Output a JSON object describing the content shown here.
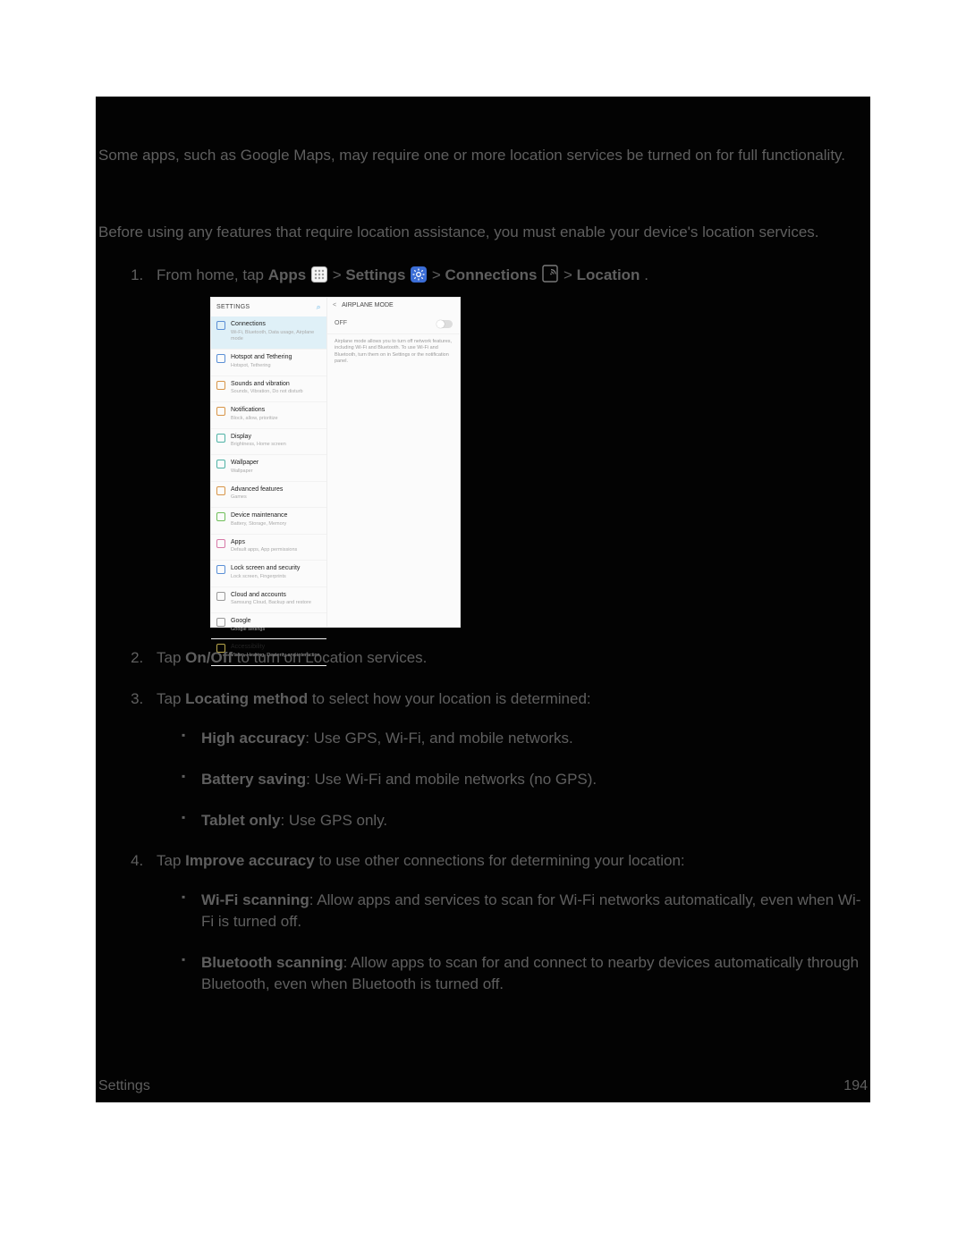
{
  "intro_text": "Some apps, such as Google Maps, may require one or more location services be turned on for full functionality.",
  "intro_text2": "Before using any features that require location assistance, you must enable your device's location services.",
  "step1": {
    "prefix": "From home, tap ",
    "apps": "Apps",
    "sep1": " > ",
    "settings": "Settings",
    "sep2": " > ",
    "connections": "Connections",
    "sep3": " > ",
    "location": "Location",
    "suffix": "."
  },
  "step2": {
    "pre": "Tap ",
    "bold": "On/Off",
    "post": " to turn on Location services."
  },
  "step3": {
    "pre": "Tap ",
    "bold": "Locating method",
    "post": " to select how your location is determined:"
  },
  "step3_items": {
    "high_accuracy": {
      "label": "High accuracy",
      "desc": ": Use GPS, Wi-Fi, and mobile networks."
    },
    "battery_saving": {
      "label": "Battery saving",
      "desc": ": Use Wi-Fi and mobile networks (no GPS)."
    },
    "tablet_only": {
      "label": "Tablet only",
      "desc": ": Use GPS only."
    }
  },
  "step4": {
    "pre": "Tap ",
    "bold": "Improve accuracy",
    "post": " to use other connections for determining your location:"
  },
  "step4_items": {
    "wifi": {
      "label": "Wi-Fi scanning",
      "desc": ": Allow apps and services to scan for Wi-Fi networks automatically, even when Wi-Fi is turned off."
    },
    "bt": {
      "label": "Bluetooth scanning",
      "desc": ": Allow apps to scan for and connect to nearby devices automatically through Bluetooth, even when Bluetooth is turned off."
    }
  },
  "deviceshot": {
    "left_header": "SETTINGS",
    "right_header": "AIRPLANE MODE",
    "off_label": "OFF",
    "airplane_desc": "Airplane mode allows you to turn off network features, including Wi-Fi and Bluetooth. To use Wi-Fi and Bluetooth, turn them on in Settings or the notification panel.",
    "items": [
      {
        "title": "Connections",
        "sub": "Wi-Fi, Bluetooth, Data usage, Airplane mode"
      },
      {
        "title": "Hotspot and Tethering",
        "sub": "Hotspot, Tethering"
      },
      {
        "title": "Sounds and vibration",
        "sub": "Sounds, Vibration, Do not disturb"
      },
      {
        "title": "Notifications",
        "sub": "Block, allow, prioritize"
      },
      {
        "title": "Display",
        "sub": "Brightness, Home screen"
      },
      {
        "title": "Wallpaper",
        "sub": "Wallpaper"
      },
      {
        "title": "Advanced features",
        "sub": "Games"
      },
      {
        "title": "Device maintenance",
        "sub": "Battery, Storage, Memory"
      },
      {
        "title": "Apps",
        "sub": "Default apps, App permissions"
      },
      {
        "title": "Lock screen and security",
        "sub": "Lock screen, Fingerprints"
      },
      {
        "title": "Cloud and accounts",
        "sub": "Samsung Cloud, Backup and restore"
      },
      {
        "title": "Google",
        "sub": "Google settings"
      },
      {
        "title": "Accessibility",
        "sub": "Vision, Hearing, Dexterity and interaction"
      }
    ]
  },
  "footer": {
    "left": "Settings",
    "right": "194"
  }
}
